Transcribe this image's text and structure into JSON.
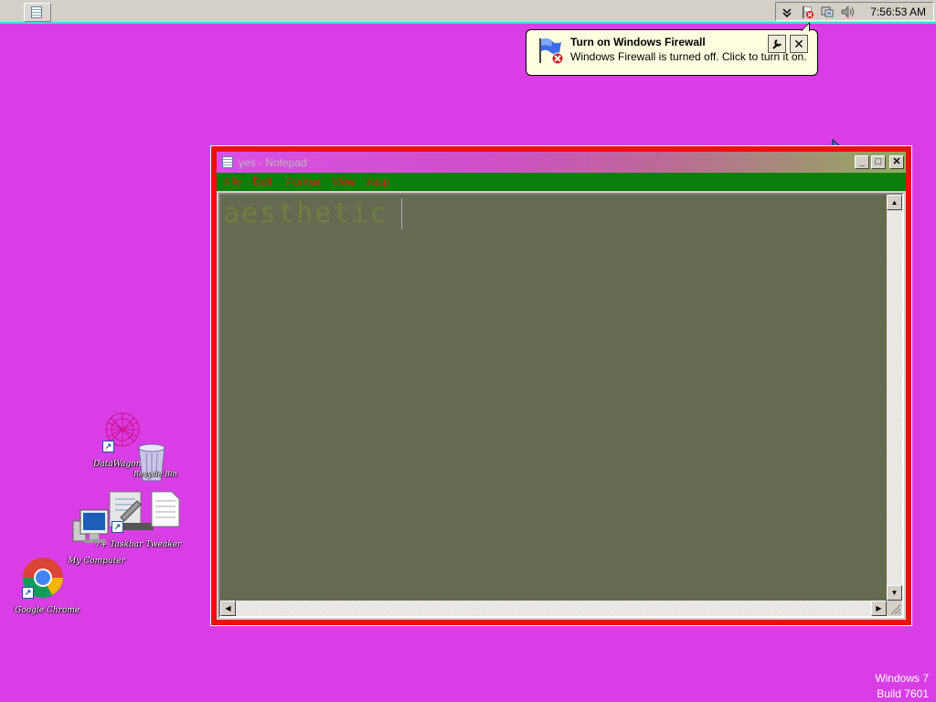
{
  "taskbar": {
    "clock": "7:56:53 AM",
    "tray_icons": [
      "chevron-down-icon",
      "action-center-flag-icon",
      "network-icon",
      "volume-icon"
    ]
  },
  "balloon": {
    "title": "Turn on Windows Firewall",
    "message": "Windows Firewall is turned off. Click to turn it on.",
    "close_label": "✕"
  },
  "notepad": {
    "title": "yes - Notepad",
    "menu": [
      "File",
      "Edit",
      "Format",
      "View",
      "Help"
    ],
    "content": "aesthetic",
    "colors": {
      "frame": "#ee1010",
      "menu_bg": "#0a7f0a",
      "menu_text": "#e01515",
      "edit_bg": "#646b52",
      "edit_text": "#6f7e3a"
    }
  },
  "desktop": {
    "background": "#d93ee6",
    "icons": [
      {
        "label": "DataWagon.com"
      },
      {
        "label": "Recycle Bin"
      },
      {
        "label": "7+ Taskbar Tweaker"
      },
      {
        "label": "My Computer"
      },
      {
        "label": "Google Chrome"
      }
    ]
  },
  "watermark": {
    "line1": "Windows 7",
    "line2": "Build 7601"
  }
}
